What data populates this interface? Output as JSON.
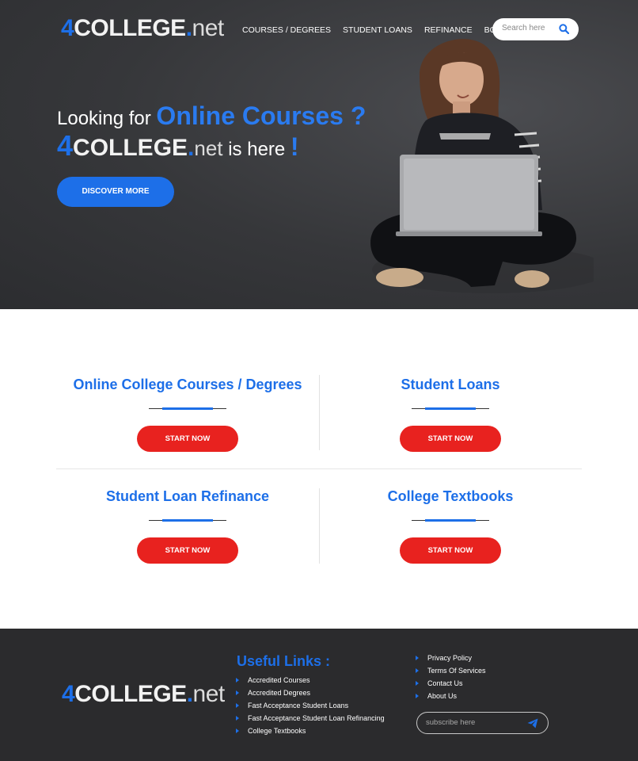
{
  "brand": {
    "four": "4",
    "college": "COLLEGE",
    "dot": ".",
    "net": "net"
  },
  "nav": [
    "COURSES / DEGREES",
    "STUDENT LOANS",
    "REFINANCE",
    "BOOKS"
  ],
  "search": {
    "placeholder": "Search here",
    "icon": "search-icon"
  },
  "hero": {
    "line1_prefix": "Looking for ",
    "line1_highlight": "Online Courses ?",
    "line2_suffix": " is here ",
    "line2_bang": "!",
    "cta": "DISCOVER MORE"
  },
  "services": [
    {
      "title": "Online College Courses / Degrees",
      "button": "START NOW"
    },
    {
      "title": "Student Loans",
      "button": "START NOW"
    },
    {
      "title": "Student Loan Refinance",
      "button": "START NOW"
    },
    {
      "title": "College Textbooks",
      "button": "START NOW"
    }
  ],
  "footer": {
    "useful_title": "Useful Links :",
    "useful_links": [
      "Accredited Courses",
      "Accredited Degrees",
      "Fast Acceptance Student Loans",
      "Fast Acceptance Student Loan Refinancing",
      "College Textbooks"
    ],
    "other_links": [
      "Privacy Policy",
      "Terms Of Services",
      "Contact Us",
      "About Us"
    ],
    "subscribe_placeholder": "subscribe here",
    "subscribe_icon": "paper-plane-icon"
  },
  "colors": {
    "accent": "#1d6fe8",
    "cta_red": "#e8221f",
    "hero_bg": "#36373a",
    "footer_bg": "#2b2b2d"
  }
}
